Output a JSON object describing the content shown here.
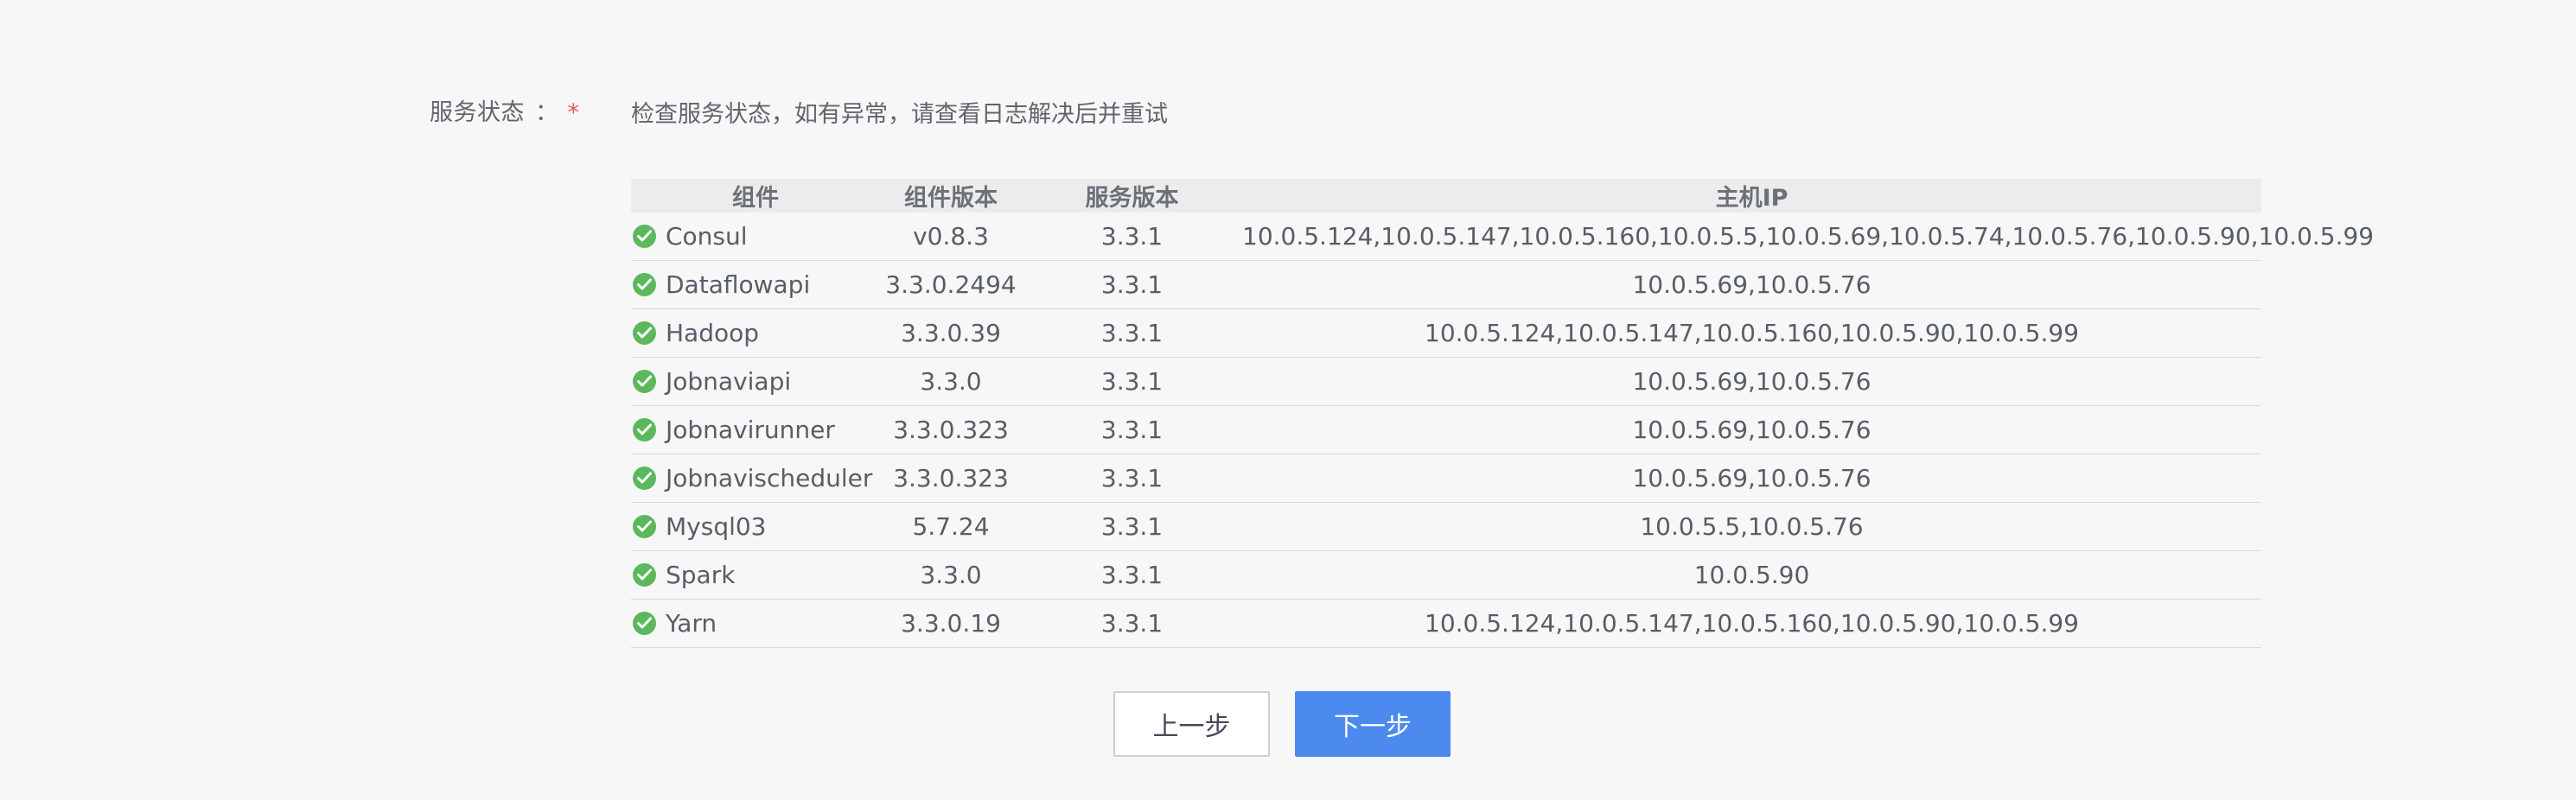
{
  "form": {
    "label": "服务状态",
    "colon": "：",
    "required_mark": "*",
    "description": "检查服务状态，如有异常，请查看日志解决后并重试"
  },
  "table": {
    "headers": {
      "component": "组件",
      "component_version": "组件版本",
      "service_version": "服务版本",
      "host_ip": "主机IP"
    },
    "status_icon": "check-circle-icon",
    "status_color": "#5cb85c",
    "rows": [
      {
        "status": "ok",
        "component": "Consul",
        "component_version": "v0.8.3",
        "service_version": "3.3.1",
        "host_ip": "10.0.5.124,10.0.5.147,10.0.5.160,10.0.5.5,10.0.5.69,10.0.5.74,10.0.5.76,10.0.5.90,10.0.5.99"
      },
      {
        "status": "ok",
        "component": "Dataflowapi",
        "component_version": "3.3.0.2494",
        "service_version": "3.3.1",
        "host_ip": "10.0.5.69,10.0.5.76"
      },
      {
        "status": "ok",
        "component": "Hadoop",
        "component_version": "3.3.0.39",
        "service_version": "3.3.1",
        "host_ip": "10.0.5.124,10.0.5.147,10.0.5.160,10.0.5.90,10.0.5.99"
      },
      {
        "status": "ok",
        "component": "Jobnaviapi",
        "component_version": "3.3.0",
        "service_version": "3.3.1",
        "host_ip": "10.0.5.69,10.0.5.76"
      },
      {
        "status": "ok",
        "component": "Jobnavirunner",
        "component_version": "3.3.0.323",
        "service_version": "3.3.1",
        "host_ip": "10.0.5.69,10.0.5.76"
      },
      {
        "status": "ok",
        "component": "Jobnavischeduler",
        "component_version": "3.3.0.323",
        "service_version": "3.3.1",
        "host_ip": "10.0.5.69,10.0.5.76"
      },
      {
        "status": "ok",
        "component": "Mysql03",
        "component_version": "5.7.24",
        "service_version": "3.3.1",
        "host_ip": "10.0.5.5,10.0.5.76"
      },
      {
        "status": "ok",
        "component": "Spark",
        "component_version": "3.3.0",
        "service_version": "3.3.1",
        "host_ip": "10.0.5.90"
      },
      {
        "status": "ok",
        "component": "Yarn",
        "component_version": "3.3.0.19",
        "service_version": "3.3.1",
        "host_ip": "10.0.5.124,10.0.5.147,10.0.5.160,10.0.5.90,10.0.5.99"
      }
    ]
  },
  "buttons": {
    "prev_label": "上一步",
    "next_label": "下一步",
    "next_color": "#4d8af0"
  }
}
